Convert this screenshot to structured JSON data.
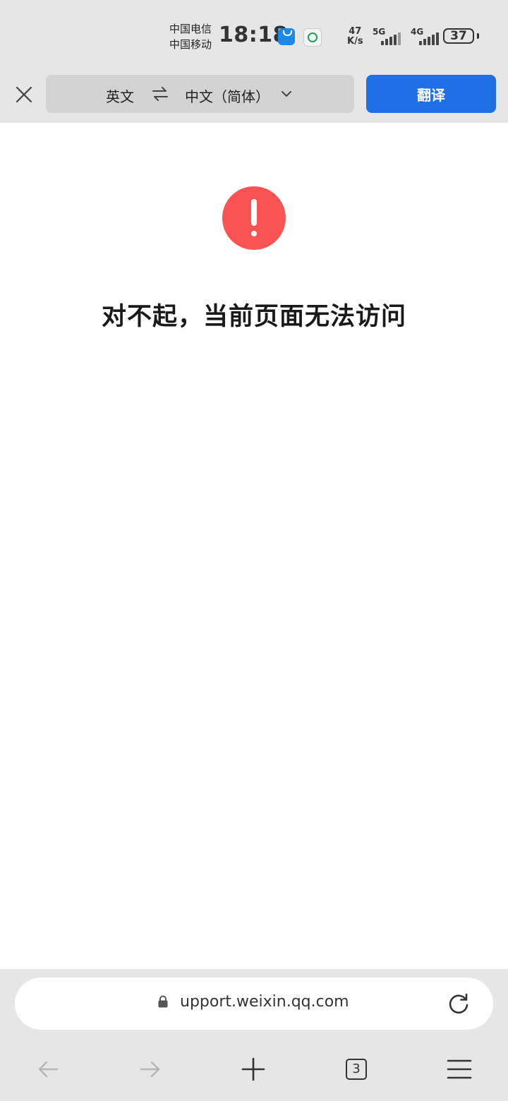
{
  "status_bar": {
    "carrier_1": "中国电信",
    "carrier_2": "中国移动",
    "time": "18:18",
    "net_speed_value": "47",
    "net_speed_unit": "K/s",
    "signal_1": "5G",
    "signal_2": "4G",
    "battery": "37"
  },
  "translate_bar": {
    "source_language": "英文",
    "target_language": "中文（简体）",
    "translate_label": "翻译"
  },
  "error": {
    "title": "对不起，当前页面无法访问"
  },
  "address_bar": {
    "url": "upport.weixin.qq.com"
  },
  "bottom_nav": {
    "tab_count": "3"
  },
  "colors": {
    "accent": "#1f6fe6",
    "error": "#f95353",
    "bar_background": "#e6e6e6"
  }
}
